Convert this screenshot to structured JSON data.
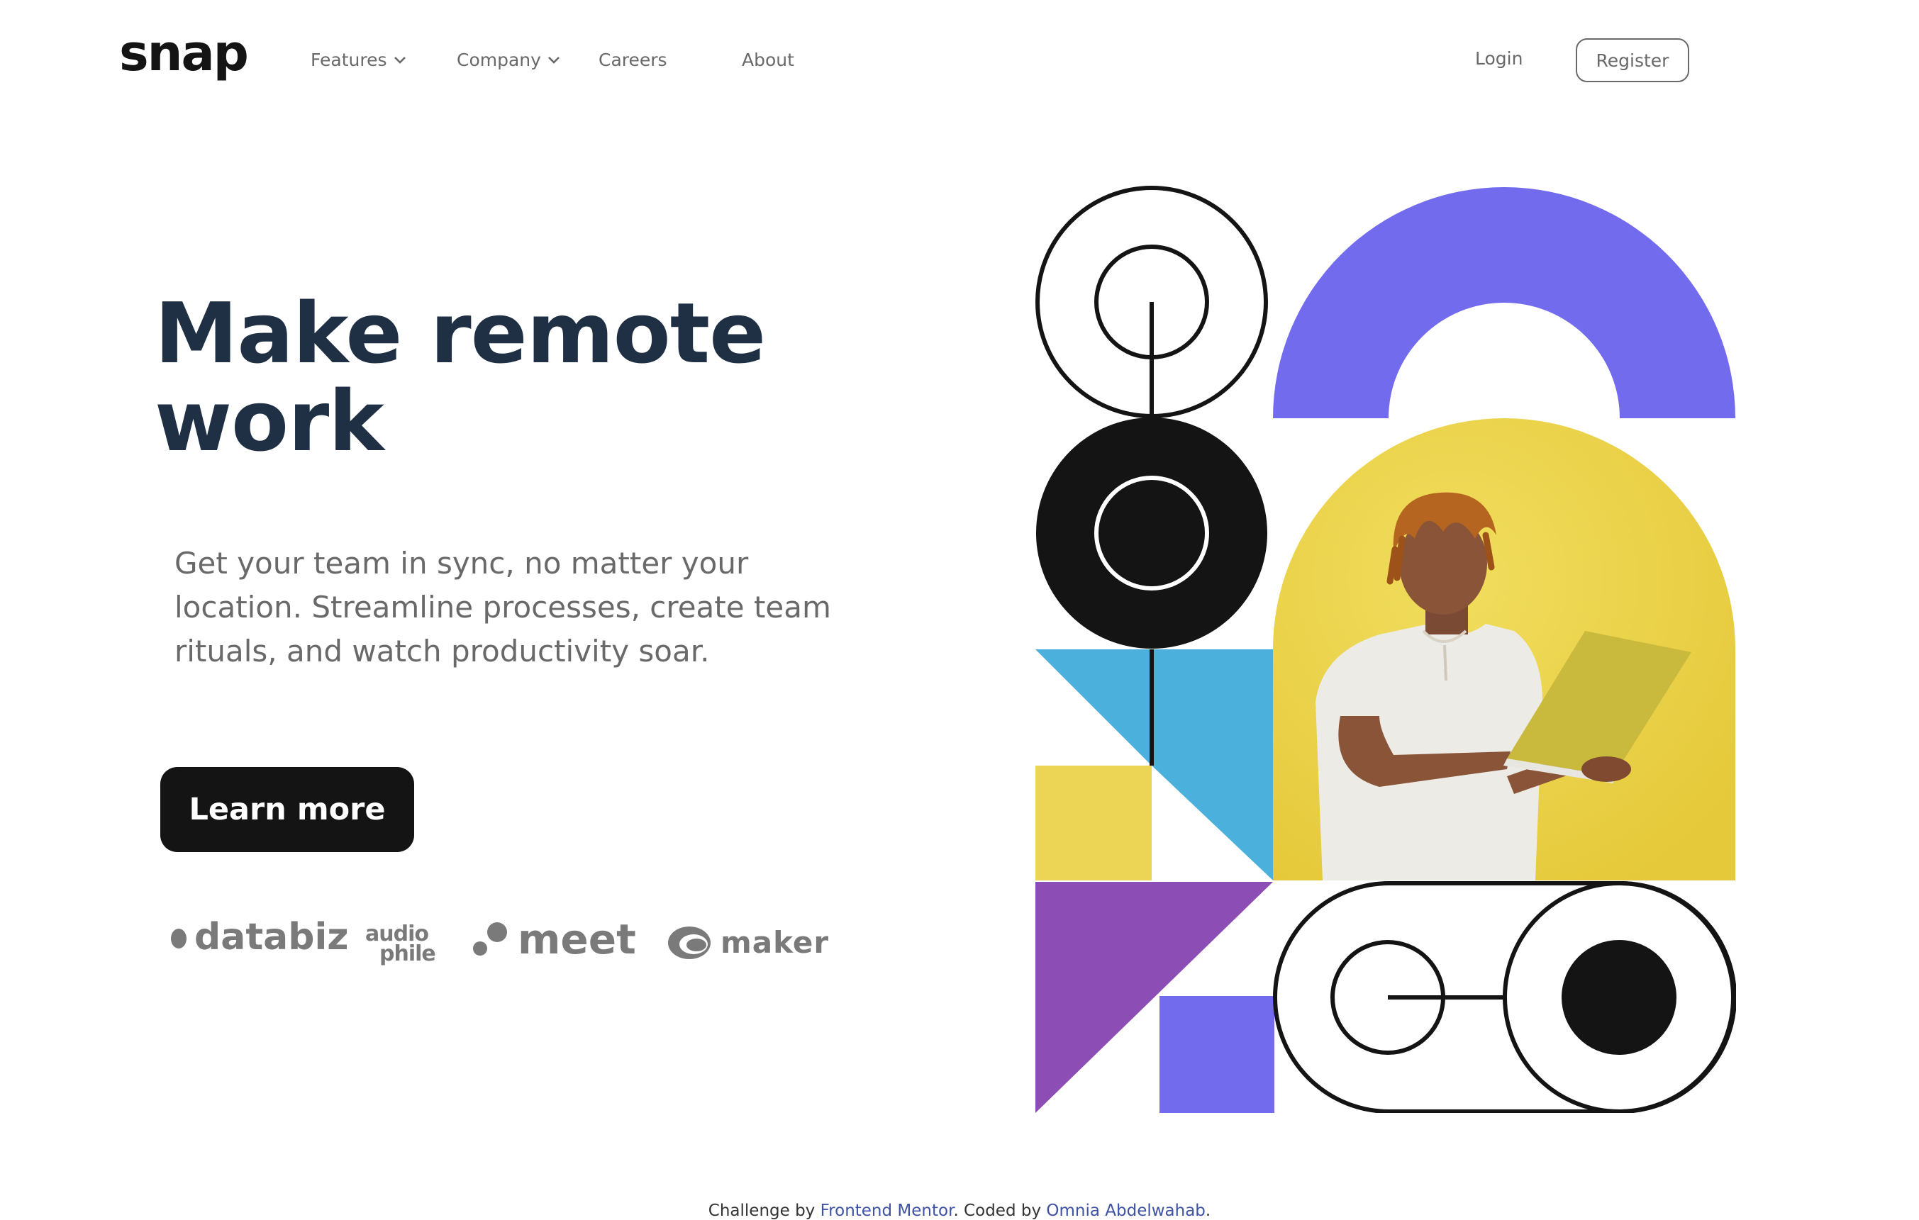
{
  "header": {
    "logo": "snap",
    "nav": {
      "features": "Features",
      "company": "Company",
      "careers": "Careers",
      "about": "About"
    },
    "login": "Login",
    "register": "Register"
  },
  "hero": {
    "title": "Make remote work",
    "description": "Get your team in sync, no matter your location. Streamline processes, create team rituals, and watch productivity soar.",
    "cta": "Learn more"
  },
  "clients": {
    "databiz": "databiz",
    "audiophile_top": "audio",
    "audiophile_bottom": "phile",
    "meet": "meet",
    "maker": "maker"
  },
  "footer": {
    "prefix": "Challenge by ",
    "link1": "Frontend Mentor",
    "middle": ". Coded by ",
    "link2": "Omnia Abdelwahab",
    "suffix": "."
  },
  "icons": {
    "chevron": "chevron-down-icon",
    "menu_arrow": "chevron-down-icon"
  },
  "colors": {
    "heading": "#1f3044",
    "body_text": "#696969",
    "button_bg": "#141414",
    "art_purple": "#726bee",
    "art_blue": "#4bb0db",
    "art_yellow": "#ecd455",
    "art_violet": "#8c4db5",
    "link": "#3e52a3"
  }
}
